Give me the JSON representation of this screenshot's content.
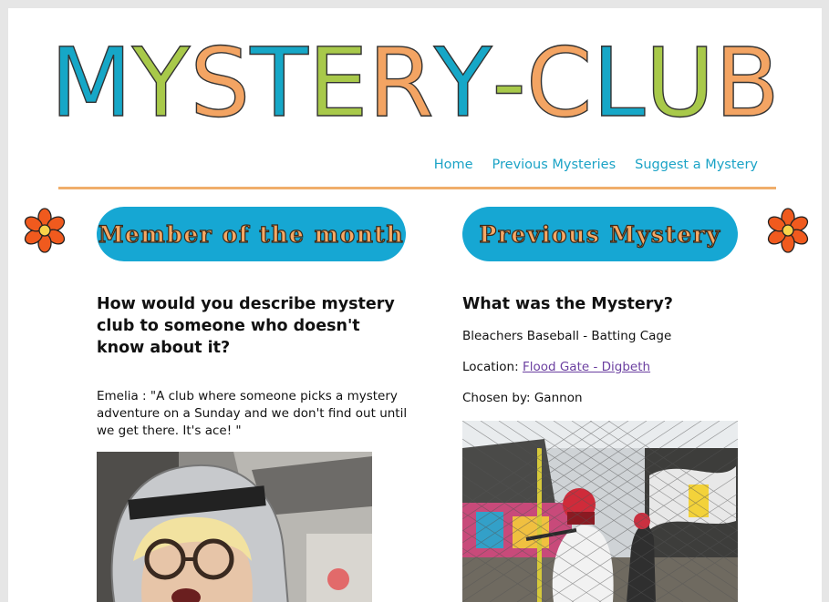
{
  "header": {
    "logo_letters": [
      {
        "char": "M",
        "color": "#16a7c7"
      },
      {
        "char": "Y",
        "color": "#a8c94a"
      },
      {
        "char": "S",
        "color": "#f3a463"
      },
      {
        "char": "T",
        "color": "#16a7c7"
      },
      {
        "char": "E",
        "color": "#a8c94a"
      },
      {
        "char": "R",
        "color": "#f3a463"
      },
      {
        "char": "Y",
        "color": "#16a7c7"
      },
      {
        "char": "-",
        "color": "#a8c94a"
      },
      {
        "char": "C",
        "color": "#f3a463"
      },
      {
        "char": "L",
        "color": "#16a7c7"
      },
      {
        "char": "U",
        "color": "#a8c94a"
      },
      {
        "char": "B",
        "color": "#f3a463"
      }
    ]
  },
  "nav": {
    "items": [
      "Home",
      "Previous Mysteries",
      "Suggest a Mystery"
    ]
  },
  "left": {
    "heading": "Member of the month",
    "question": "How would you describe mystery club to someone who doesn't know about it?",
    "quote": "Emelia : \"A club where someone picks a mystery adventure on a Sunday and we don't find out until we get there. It's ace! \""
  },
  "right": {
    "heading": "Previous Mystery",
    "question": "What was the Mystery?",
    "mystery": "Bleachers Baseball - Batting Cage",
    "location_label": "Location:",
    "location_link": "Flood Gate - Digbeth",
    "chosen_by": "Chosen by: Gannon"
  },
  "colors": {
    "accent_blue": "#16a7d3",
    "accent_orange": "#f0ae6b",
    "accent_green": "#a8c94a",
    "nav_text": "#1ba3c6"
  },
  "icons": [
    "flower-icon",
    "flower-icon"
  ]
}
